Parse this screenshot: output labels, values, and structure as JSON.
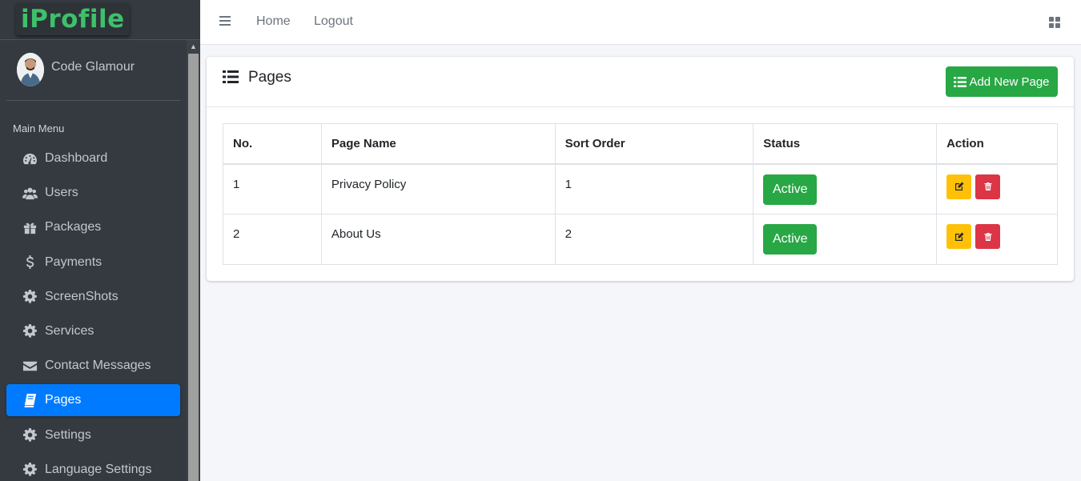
{
  "app": {
    "logo_text": "iProfile"
  },
  "user": {
    "name": "Code Glamour"
  },
  "sidebar": {
    "header": "Main Menu",
    "items": [
      {
        "label": "Dashboard",
        "icon": "dashboard-icon"
      },
      {
        "label": "Users",
        "icon": "users-icon"
      },
      {
        "label": "Packages",
        "icon": "gift-icon"
      },
      {
        "label": "Payments",
        "icon": "dollar-icon"
      },
      {
        "label": "ScreenShots",
        "icon": "gear-icon"
      },
      {
        "label": "Services",
        "icon": "gear-icon"
      },
      {
        "label": "Contact Messages",
        "icon": "envelope-icon"
      },
      {
        "label": "Pages",
        "icon": "book-icon",
        "active": true
      },
      {
        "label": "Settings",
        "icon": "gear-icon"
      },
      {
        "label": "Language Settings",
        "icon": "gear-icon"
      }
    ]
  },
  "topbar": {
    "home": "Home",
    "logout": "Logout"
  },
  "card": {
    "title": "Pages",
    "add_button": "Add New Page"
  },
  "table": {
    "headers": [
      "No.",
      "Page Name",
      "Sort Order",
      "Status",
      "Action"
    ],
    "rows": [
      {
        "no": "1",
        "name": "Privacy Policy",
        "sort": "1",
        "status": "Active"
      },
      {
        "no": "2",
        "name": "About Us",
        "sort": "2",
        "status": "Active"
      }
    ]
  },
  "colors": {
    "sidebar_bg": "#343a40",
    "active": "#007bff",
    "success": "#28a745",
    "warning": "#ffc107",
    "danger": "#dc3545"
  }
}
